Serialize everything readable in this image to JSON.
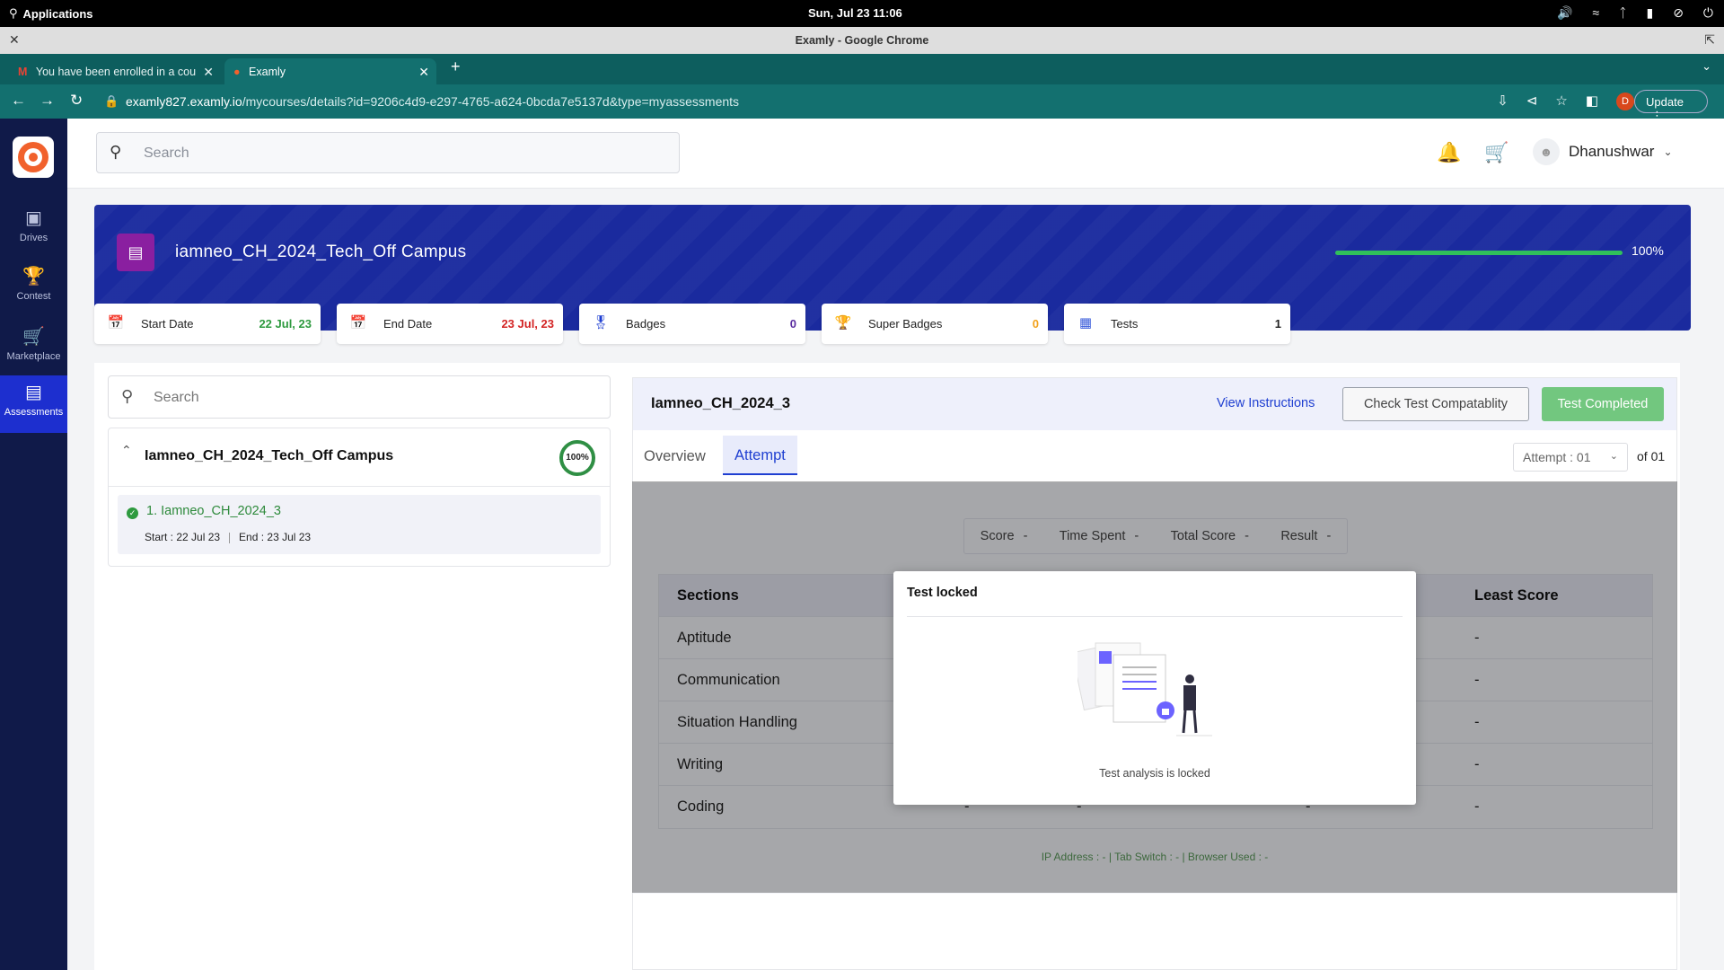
{
  "os": {
    "apps_label": "Applications",
    "clock": "Sun, Jul 23      11:06"
  },
  "window": {
    "title": "Examly - Google Chrome"
  },
  "tabs": [
    {
      "label": "You have been enrolled in a cou"
    },
    {
      "label": "Examly"
    }
  ],
  "url": {
    "host": "examly827.examly.io",
    "path": "/mycourses/details?id=9206c4d9-e297-4765-a624-0bcda7e5137d&type=myassessments",
    "profile_initial": "D",
    "update_label": "Update"
  },
  "sidebar": {
    "items": [
      {
        "label": "Drives",
        "icon": "briefcase-icon"
      },
      {
        "label": "Contest",
        "icon": "trophy-icon"
      },
      {
        "label": "Marketplace",
        "icon": "cart-icon"
      },
      {
        "label": "Assessments",
        "icon": "assessments-icon"
      }
    ]
  },
  "header": {
    "search_placeholder": "Search",
    "user_name": "Dhanushwar"
  },
  "banner": {
    "title": "iamneo_CH_2024_Tech_Off Campus",
    "progress": 100,
    "progress_label": "100%"
  },
  "stats": [
    {
      "label": "Start Date",
      "value": "22 Jul, 23",
      "color": "#2e9a3f"
    },
    {
      "label": "End Date",
      "value": "23 Jul, 23",
      "color": "#d32424"
    },
    {
      "label": "Badges",
      "value": "0",
      "color": "#5a2da0"
    },
    {
      "label": "Super Badges",
      "value": "0",
      "color": "#f2a11b"
    },
    {
      "label": "Tests",
      "value": "1",
      "color": "#222222"
    }
  ],
  "left": {
    "search_placeholder": "Search",
    "course_title": "Iamneo_CH_2024_Tech_Off Campus",
    "course_progress": "100%",
    "test_name": "1. Iamneo_CH_2024_3",
    "start": "Start : 22 Jul 23",
    "end": "End : 23 Jul 23"
  },
  "right": {
    "title": "Iamneo_CH_2024_3",
    "view_instructions": "View Instructions",
    "check_compat": "Check Test Compatablity",
    "status_button": "Test Completed",
    "tab_overview": "Overview",
    "tab_attempt": "Attempt",
    "attempt_select": "Attempt : 01",
    "attempt_of": "of 01",
    "score_bar": {
      "score_label": "Score",
      "score_value": "-",
      "time_label": "Time Spent",
      "time_value": "-",
      "total_label": "Total Score",
      "total_value": "-",
      "result_label": "Result",
      "result_value": "-"
    },
    "table_headers": {
      "sections": "Sections",
      "least": "Least Score"
    },
    "rows": [
      {
        "section": "Aptitude",
        "c2": "",
        "c3": "",
        "c4": "",
        "least": "-"
      },
      {
        "section": "Communication",
        "c2": "",
        "c3": "",
        "c4": "",
        "least": "-"
      },
      {
        "section": "Situation Handling",
        "c2": "",
        "c3": "",
        "c4": "",
        "least": "-"
      },
      {
        "section": "Writing",
        "c2": "",
        "c3": "",
        "c4": "",
        "least": "-"
      },
      {
        "section": "Coding",
        "c2": "-",
        "c3": "-",
        "c4": "-",
        "least": "-"
      }
    ],
    "ip_line": "IP Address : - | Tab Switch : - | Browser Used : -"
  },
  "modal": {
    "title": "Test locked",
    "message": "Test analysis is locked"
  }
}
